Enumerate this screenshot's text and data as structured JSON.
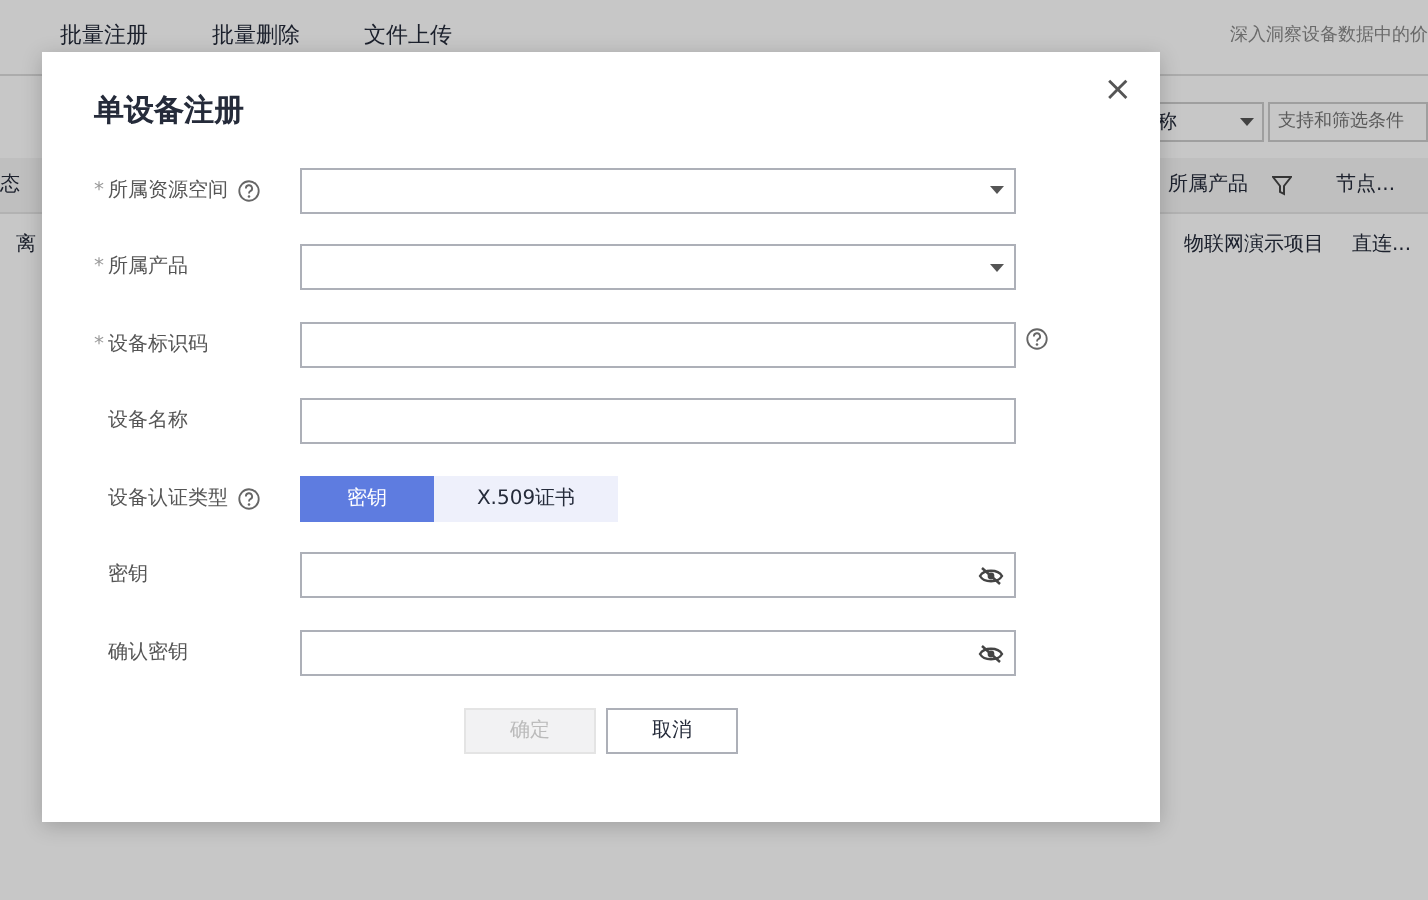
{
  "background": {
    "tabs": [
      "批量注册",
      "批量删除",
      "文件上传"
    ],
    "hint": "深入洞察设备数据中的价",
    "filter_select": "称",
    "search": {
      "placeholder": "支持和筛选条件"
    },
    "table": {
      "columns": [
        "态",
        "所属产品",
        "节点..."
      ],
      "rows": [
        [
          "离",
          "物联网演示项目",
          "直连..."
        ]
      ]
    }
  },
  "dialog": {
    "title": "单设备注册",
    "close": "×",
    "fields": [
      {
        "label": "所属资源空间",
        "required_mark": "*",
        "help": true,
        "kind": "select"
      },
      {
        "label": "所属产品",
        "required_mark": "*",
        "kind": "select"
      },
      {
        "label": "设备标识码",
        "required_mark": "*",
        "help": true,
        "help_beside_field": true,
        "kind": "text"
      },
      {
        "label": "设备名称",
        "kind": "text"
      },
      {
        "label": "设备认证类型",
        "help": true,
        "kind": "toggle",
        "options": [
          {
            "label": "密钥",
            "selected": true
          },
          {
            "label": "X.509证书",
            "selected": false
          }
        ]
      },
      {
        "label": "密钥",
        "kind": "password"
      },
      {
        "label": "确认密钥",
        "kind": "password"
      }
    ],
    "buttons": [
      {
        "label": "确定",
        "disabled": true
      },
      {
        "label": "取消",
        "disabled": false
      }
    ]
  }
}
